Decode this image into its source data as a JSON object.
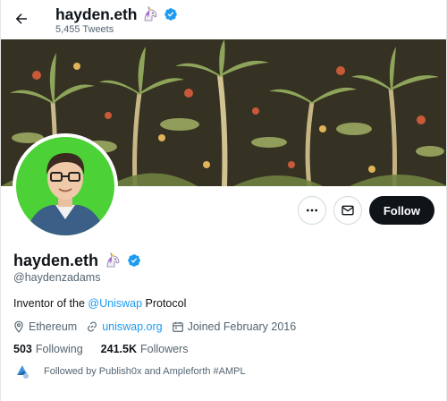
{
  "header": {
    "name": "hayden.eth",
    "tweet_count": "5,455 Tweets"
  },
  "profile": {
    "name": "hayden.eth",
    "handle": "@haydenzadams",
    "bio_prefix": "Inventor of the ",
    "bio_mention": "@Uniswap",
    "bio_suffix": " Protocol",
    "location": "Ethereum",
    "website": "uniswap.org",
    "joined": "Joined February 2016",
    "following_count": "503",
    "following_label": "Following",
    "followers_count": "241.5K",
    "followers_label": "Followers",
    "followed_by": "Followed by Publish0x and Ampleforth #AMPL"
  },
  "actions": {
    "follow_label": "Follow"
  },
  "icons": {
    "back": "arrow-left-icon",
    "verified": "verified-badge-icon",
    "unicorn": "unicorn-emoji-icon",
    "more": "more-dots-icon",
    "message": "envelope-icon",
    "location": "location-pin-icon",
    "link": "link-icon",
    "calendar": "calendar-icon"
  },
  "colors": {
    "accent": "#1d9bf0",
    "text_primary": "#0f1419",
    "text_secondary": "#536471",
    "follow_button_bg": "#0f1419",
    "avatar_background": "#4cd137"
  }
}
